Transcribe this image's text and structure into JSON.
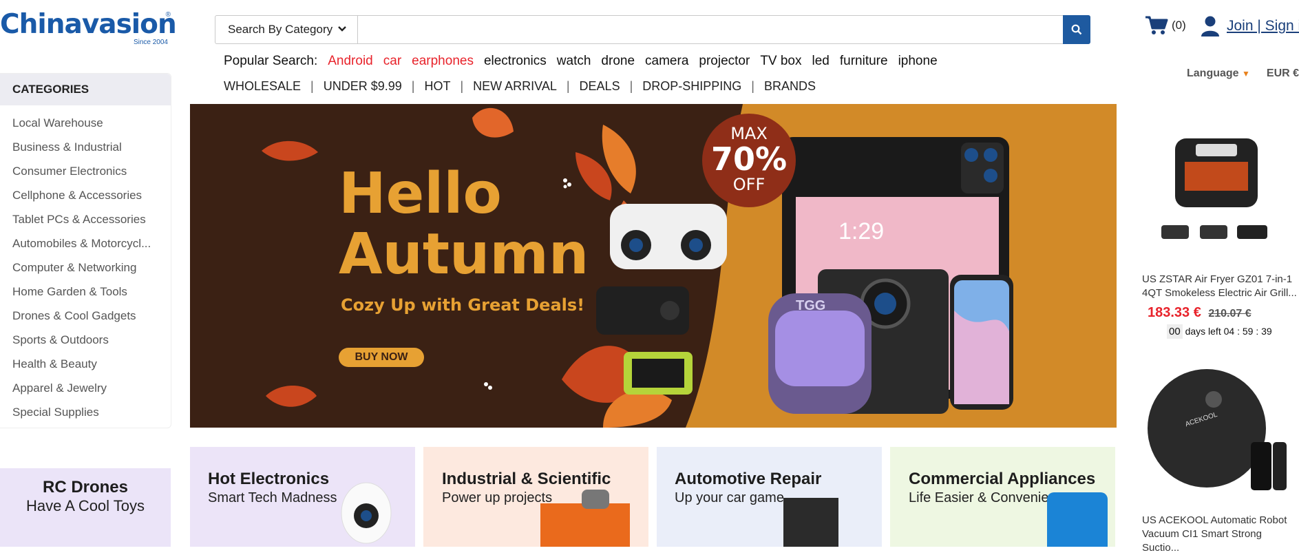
{
  "logo": {
    "brand": "Chinavasion",
    "since": "Since 2004",
    "reg": "®"
  },
  "search": {
    "category_label": "Search By Category",
    "placeholder": ""
  },
  "cart": {
    "count": "(0)"
  },
  "account": {
    "label": "Join | Sign in"
  },
  "popular": {
    "label": "Popular Search:",
    "terms": [
      "Android",
      "car",
      "earphones",
      "electronics",
      "watch",
      "drone",
      "camera",
      "projector",
      "TV box",
      "led",
      "furniture",
      "iphone"
    ]
  },
  "quicknav": [
    "WHOLESALE",
    "UNDER $9.99",
    "HOT",
    "NEW ARRIVAL",
    "DEALS",
    "DROP-SHIPPING",
    "BRANDS"
  ],
  "settings": {
    "language": "Language",
    "currency": "EUR €"
  },
  "categories": {
    "title": "CATEGORIES",
    "items": [
      "Local Warehouse",
      "Business & Industrial",
      "Consumer Electronics",
      "Cellphone & Accessories",
      "Tablet PCs & Accessories",
      "Automobiles & Motorcycl...",
      "Computer & Networking",
      "Home Garden & Tools",
      "Drones & Cool Gadgets",
      "Sports & Outdoors",
      "Health & Beauty",
      "Apparel & Jewelry",
      "Special Supplies"
    ]
  },
  "banner": {
    "line1": "Hello",
    "line2": "Autumn",
    "tagline": "Cozy Up with Great Deals!",
    "cta": "BUY NOW",
    "badge_top": "MAX",
    "badge_mid": "70%",
    "badge_bottom": "OFF",
    "screen_time": "1:29",
    "speaker_brand": "TGG"
  },
  "promo": {
    "title": "RC Drones",
    "subtitle": "Have A Cool Toys"
  },
  "tiles": [
    {
      "title": "Hot Electronics",
      "subtitle": "Smart Tech Madness",
      "bg": "#ece4f8"
    },
    {
      "title": "Industrial & Scientific",
      "subtitle": "Power up projects",
      "bg": "#fde9df"
    },
    {
      "title": "Automotive Repair",
      "subtitle": "Up your car game",
      "bg": "#eaeef9"
    },
    {
      "title": "Commercial Appliances",
      "subtitle": "Life Easier & Convenient",
      "bg": "#eef7e2"
    }
  ],
  "deals": [
    {
      "name": "US ZSTAR Air Fryer GZ01 7-in-1 4QT Smokeless Electric Air Grill...",
      "price": "183.33 €",
      "old_price": "210.07 €",
      "days": "00",
      "days_label": "days left",
      "time": "04 : 59 : 39"
    },
    {
      "name": "US ACEKOOL Automatic Robot Vacuum CI1 Smart Strong Suctio...",
      "brand": "ACEKOOL"
    }
  ],
  "colors": {
    "brand": "#1a5aa8",
    "accent_red": "#e8232b",
    "banner_brown": "#3b2114",
    "banner_orange": "#d28a28"
  }
}
